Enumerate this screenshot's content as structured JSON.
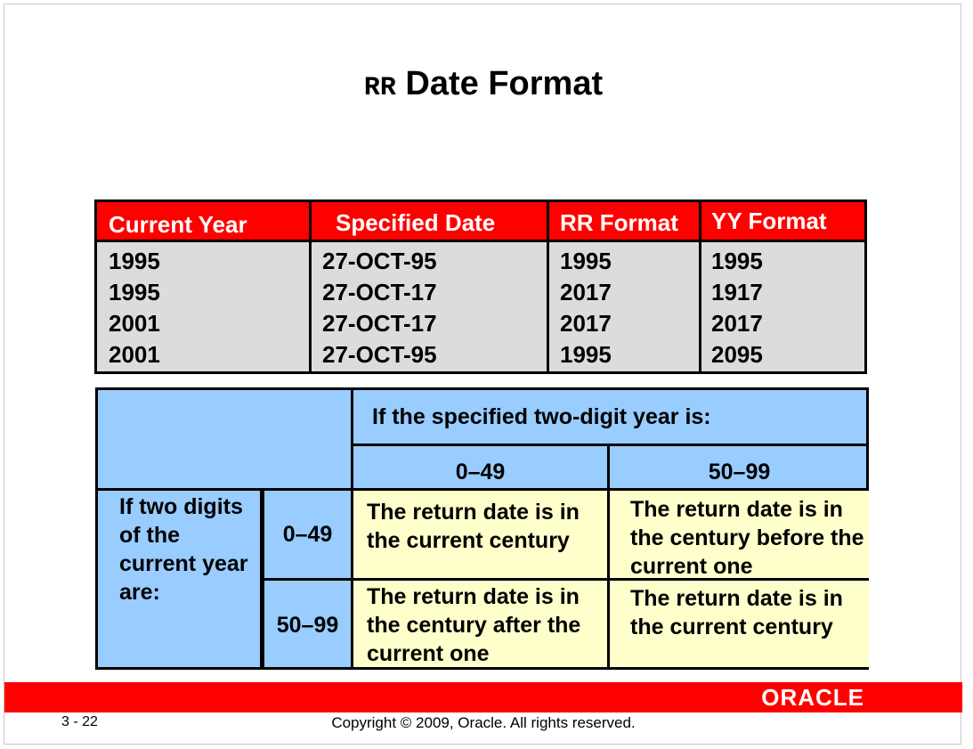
{
  "slide": {
    "title_code": "RR",
    "title_text": "Date Format"
  },
  "table1": {
    "headers": [
      "Current Year",
      "Specified Date",
      "RR Format",
      "YY Format"
    ],
    "rows": [
      [
        "1995",
        "27-OCT-95",
        "1995",
        "1995"
      ],
      [
        "1995",
        "27-OCT-17",
        "2017",
        "1917"
      ],
      [
        "2001",
        "27-OCT-17",
        "2017",
        "2017"
      ],
      [
        "2001",
        "27-OCT-95",
        "1995",
        "2095"
      ]
    ]
  },
  "table2": {
    "top_header": "If the specified two-digit year is:",
    "col_ranges": [
      "0–49",
      "50–99"
    ],
    "row_header": "If two digits of the current year are:",
    "row_ranges": [
      "0–49",
      "50–99"
    ],
    "cells": [
      [
        "The return date is in the current century",
        "The return date is in the century before the current one"
      ],
      [
        "The return date is in the century after the current one",
        "The return date is in the current century"
      ]
    ]
  },
  "footer": {
    "brand": "ORACLE",
    "page_number": "3 - 22",
    "copyright": "Copyright © 2009, Oracle. All rights reserved."
  },
  "colors": {
    "header_red": "#ff0000",
    "row_gray": "#dcdcdc",
    "light_blue": "#99ccff",
    "pale_yellow": "#ffffcc"
  }
}
